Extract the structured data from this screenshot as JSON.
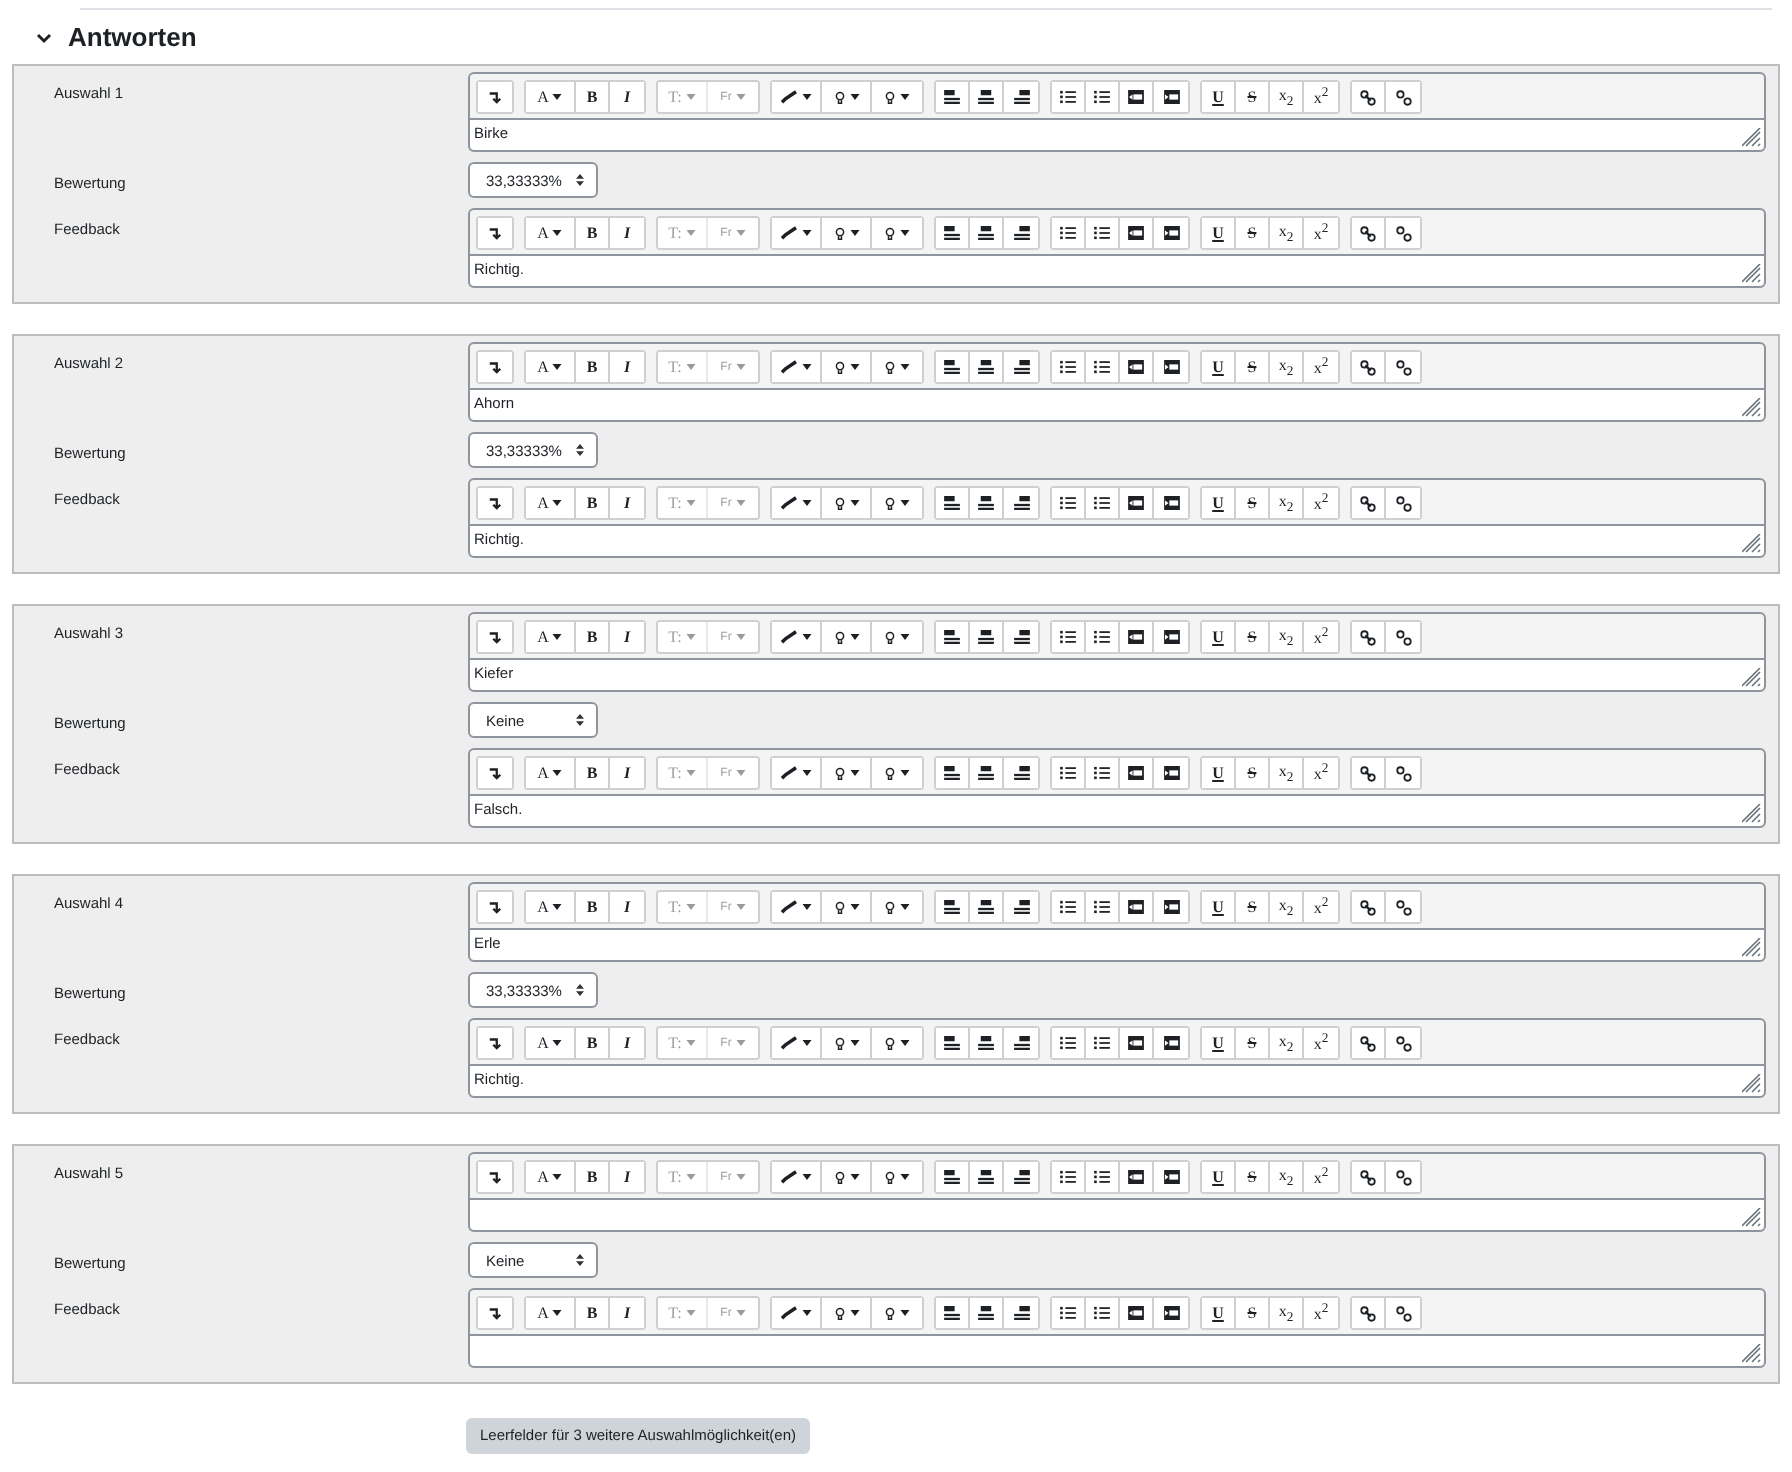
{
  "section": {
    "title": "Antworten",
    "expanded": true
  },
  "answers": [
    {
      "label": "Auswahl 1",
      "answer": {
        "text": "Birke",
        "toolbar": [
          {
            "label": "A",
            "disabled": false
          },
          {
            "label": "B",
            "disabled": false
          },
          {
            "label": "I",
            "disabled": false
          },
          {
            "label": "T:",
            "disabled": true
          },
          {
            "label": "Fr",
            "disabled": true
          },
          {
            "label": "U",
            "disabled": false
          },
          {
            "label": "S",
            "disabled": false
          },
          {
            "label": "x$_{2}$",
            "disabled": false
          },
          {
            "label": "x$^{2}$",
            "disabled": false
          }
        ]
      },
      "grade_label": "Bewertung",
      "grade": "33,33333%",
      "feedback_label": "Feedback",
      "feedback": {
        "text": "Richtig.",
        "toolbar": [
          {
            "label": "A",
            "disabled": false
          },
          {
            "label": "B",
            "disabled": false
          },
          {
            "label": "I",
            "disabled": false
          },
          {
            "label": "T:",
            "disabled": true
          },
          {
            "label": "Fr",
            "disabled": true
          },
          {
            "label": "U",
            "disabled": false
          },
          {
            "label": "S",
            "disabled": false
          },
          {
            "label": "x$_{2}$",
            "disabled": false
          },
          {
            "label": "x$^{2}$",
            "disabled": false
          }
        ]
      }
    },
    {
      "label": "Auswahl 2",
      "answer": {
        "text": "Ahorn",
        "toolbar": [
          {
            "label": "A",
            "disabled": false
          },
          {
            "label": "B",
            "disabled": false
          },
          {
            "label": "I",
            "disabled": false
          },
          {
            "label": "T:",
            "disabled": true
          },
          {
            "label": "Fr",
            "disabled": true
          },
          {
            "label": "U",
            "disabled": false
          },
          {
            "label": "S",
            "disabled": false
          },
          {
            "label": "x$_{2}$",
            "disabled": false
          },
          {
            "label": "x$^{2}$",
            "disabled": false
          }
        ]
      },
      "grade_label": "Bewertung",
      "grade": "33,33333%",
      "feedback_label": "Feedback",
      "feedback": {
        "text": "Richtig.",
        "toolbar": [
          {
            "label": "A",
            "disabled": false
          },
          {
            "label": "B",
            "disabled": false
          },
          {
            "label": "I",
            "disabled": false
          },
          {
            "label": "T:",
            "disabled": true
          },
          {
            "label": "Fr",
            "disabled": true
          },
          {
            "label": "U",
            "disabled": false
          },
          {
            "label": "S",
            "disabled": false
          },
          {
            "label": "x$_{2}$",
            "disabled": false
          },
          {
            "label": "x$^{2}$",
            "disabled": false
          }
        ]
      }
    },
    {
      "label": "Auswahl 3",
      "answer": {
        "text": "Kiefer",
        "toolbar": [
          {
            "label": "A",
            "disabled": false
          },
          {
            "label": "B",
            "disabled": false
          },
          {
            "label": "I",
            "disabled": false
          },
          {
            "label": "T:",
            "disabled": true
          },
          {
            "label": "Fr",
            "disabled": true
          },
          {
            "label": "U",
            "disabled": false
          },
          {
            "label": "S",
            "disabled": false
          },
          {
            "label": "x$_{2}$",
            "disabled": false
          },
          {
            "label": "x$^{2}$",
            "disabled": false
          }
        ]
      },
      "grade_label": "Bewertung",
      "grade": "Keine",
      "feedback_label": "Feedback",
      "feedback": {
        "text": "Falsch.",
        "toolbar": [
          {
            "label": "A",
            "disabled": false
          },
          {
            "label": "B",
            "disabled": false
          },
          {
            "label": "I",
            "disabled": false
          },
          {
            "label": "T:",
            "disabled": true
          },
          {
            "label": "Fr",
            "disabled": true
          },
          {
            "label": "U",
            "disabled": false
          },
          {
            "label": "S",
            "disabled": false
          },
          {
            "label": "x$_{2}$",
            "disabled": false
          },
          {
            "label": "x$^{2}$",
            "disabled": false
          }
        ]
      }
    },
    {
      "label": "Auswahl 4",
      "answer": {
        "text": "Erle",
        "toolbar": [
          {
            "label": "A",
            "disabled": false
          },
          {
            "label": "B",
            "disabled": false
          },
          {
            "label": "I",
            "disabled": false
          },
          {
            "label": "T:",
            "disabled": true
          },
          {
            "label": "Fr",
            "disabled": true
          },
          {
            "label": "U",
            "disabled": false
          },
          {
            "label": "S",
            "disabled": false
          },
          {
            "label": "x$_{2}$",
            "disabled": false
          },
          {
            "label": "x$^{2}$",
            "disabled": false
          }
        ]
      },
      "grade_label": "Bewertung",
      "grade": "33,33333%",
      "feedback_label": "Feedback",
      "feedback": {
        "text": "Richtig.",
        "toolbar": [
          {
            "label": "A",
            "disabled": false
          },
          {
            "label": "B",
            "disabled": false
          },
          {
            "label": "I",
            "disabled": false
          },
          {
            "label": "T:",
            "disabled": true
          },
          {
            "label": "Fr",
            "disabled": true
          },
          {
            "label": "U",
            "disabled": false
          },
          {
            "label": "S",
            "disabled": false
          },
          {
            "label": "x$_{2}$",
            "disabled": false
          },
          {
            "label": "x$^{2}$",
            "disabled": false
          }
        ]
      }
    },
    {
      "label": "Auswahl 5",
      "answer": {
        "toolbar": [
          {
            "label": "A",
            "disabled": false
          },
          {
            "label": "B",
            "disabled": false
          },
          {
            "label": "I",
            "disabled": false
          },
          {
            "label": "T:",
            "disabled": true
          },
          {
            "label": "Fr",
            "disabled": true
          },
          {
            "label": "U",
            "disabled": false
          },
          {
            "label": "S",
            "disabled": false
          },
          {
            "label": "x$_{2}$",
            "disabled": false
          },
          {
            "label": "x$^{2}$",
            "disabled": false
          }
        ]
      },
      "grade_label": "Bewertung",
      "grade": "Keine",
      "feedback_label": "Feedback",
      "feedback": {
        "toolbar": [
          {
            "label": "A",
            "disabled": false
          },
          {
            "label": "B",
            "disabled": false
          },
          {
            "label": "I",
            "disabled": false
          },
          {
            "label": "T:",
            "disabled": true
          },
          {
            "label": "Fr",
            "disabled": true
          },
          {
            "label": "U",
            "disabled": false
          },
          {
            "label": "S",
            "disabled": false
          },
          {
            "label": "x$_{2}$",
            "disabled": false
          },
          {
            "label": "x$^{2}$",
            "disabled": false
          }
        ]
      }
    }
  ],
  "add_button": "Leerfelder für 3 weitere Auswahlmöglichkeit(en)"
}
